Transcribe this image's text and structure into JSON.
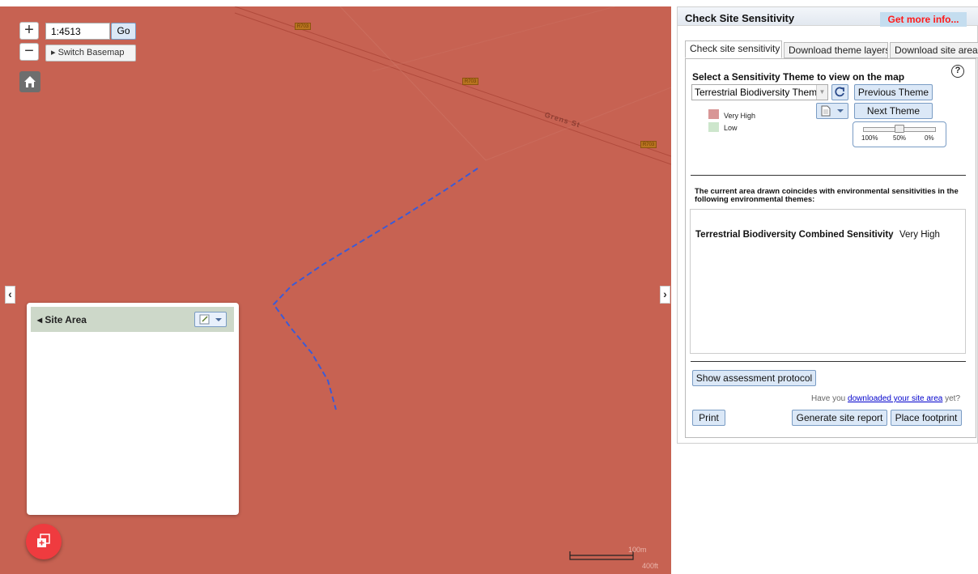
{
  "map": {
    "scale_value": "1:4513",
    "go_label": "Go",
    "zoom_in": "+",
    "zoom_out": "−",
    "basemap_label": "▸ Switch Basemap",
    "street_name": "Grens St",
    "road_shields": [
      "R703",
      "R703",
      "R703"
    ],
    "scale_bar": {
      "top_label": "100m",
      "bottom_label": "400ft"
    },
    "colors": {
      "sensitivity_fill": "#c76252",
      "site_outline": "#3b5bd6"
    },
    "collapse_left": "‹",
    "collapse_right": "›"
  },
  "site_panel": {
    "title": "◂ Site Area"
  },
  "panel": {
    "title": "Check Site Sensitivity",
    "more_info": "Get more info...",
    "tabs": [
      {
        "label": "Check site sensitivity",
        "active": true
      },
      {
        "label": "Download theme layers",
        "active": false
      },
      {
        "label": "Download site area",
        "active": false
      }
    ],
    "theme_heading": "Select a Sensitivity Theme to view on the map",
    "help": "?",
    "theme_select_value": "Terrestrial Biodiversity Theme",
    "previous_theme": "Previous Theme",
    "next_theme": "Next Theme",
    "legend": [
      {
        "label": "Very High",
        "color": "#d89696"
      },
      {
        "label": "Low",
        "color": "#cde6cc"
      }
    ],
    "opacity": {
      "value_percent": 50,
      "labels": [
        "100%",
        "50%",
        "0%"
      ]
    },
    "coincide_text": "The current area drawn coincides with environmental sensitivities in the following environmental themes:",
    "results": [
      {
        "theme": "Terrestrial Biodiversity Combined Sensitivity",
        "level": "Very High"
      }
    ],
    "assessment_button": "Show assessment protocol",
    "download_note_prefix": "Have you ",
    "download_note_link": "downloaded your site area",
    "download_note_suffix": " yet?",
    "print_button": "Print",
    "report_button": "Generate site report",
    "footprint_button": "Place footprint"
  }
}
